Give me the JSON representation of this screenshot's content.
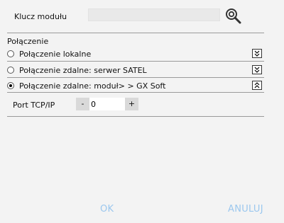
{
  "module_key": {
    "label": "Klucz modułu",
    "value": "",
    "search_icon": "magnifier-icon"
  },
  "connection": {
    "group_title": "Połączenie",
    "options": [
      {
        "label": "Połączenie lokalne",
        "checked": false,
        "expanded": false
      },
      {
        "label": "Połączenie zdalne: serwer SATEL",
        "checked": false,
        "expanded": false
      },
      {
        "label": "Połączenie zdalne: moduł> > GX Soft",
        "checked": true,
        "expanded": true
      }
    ]
  },
  "port": {
    "label": "Port TCP/IP",
    "minus": "-",
    "plus": "+",
    "value": "0"
  },
  "footer": {
    "ok": "OK",
    "cancel": "ANULUJ"
  },
  "colors": {
    "accent": "#9bc7ee",
    "background": "#f3f3f3",
    "separator": "#9a9a9a",
    "stepper": "#d9d9d9"
  }
}
